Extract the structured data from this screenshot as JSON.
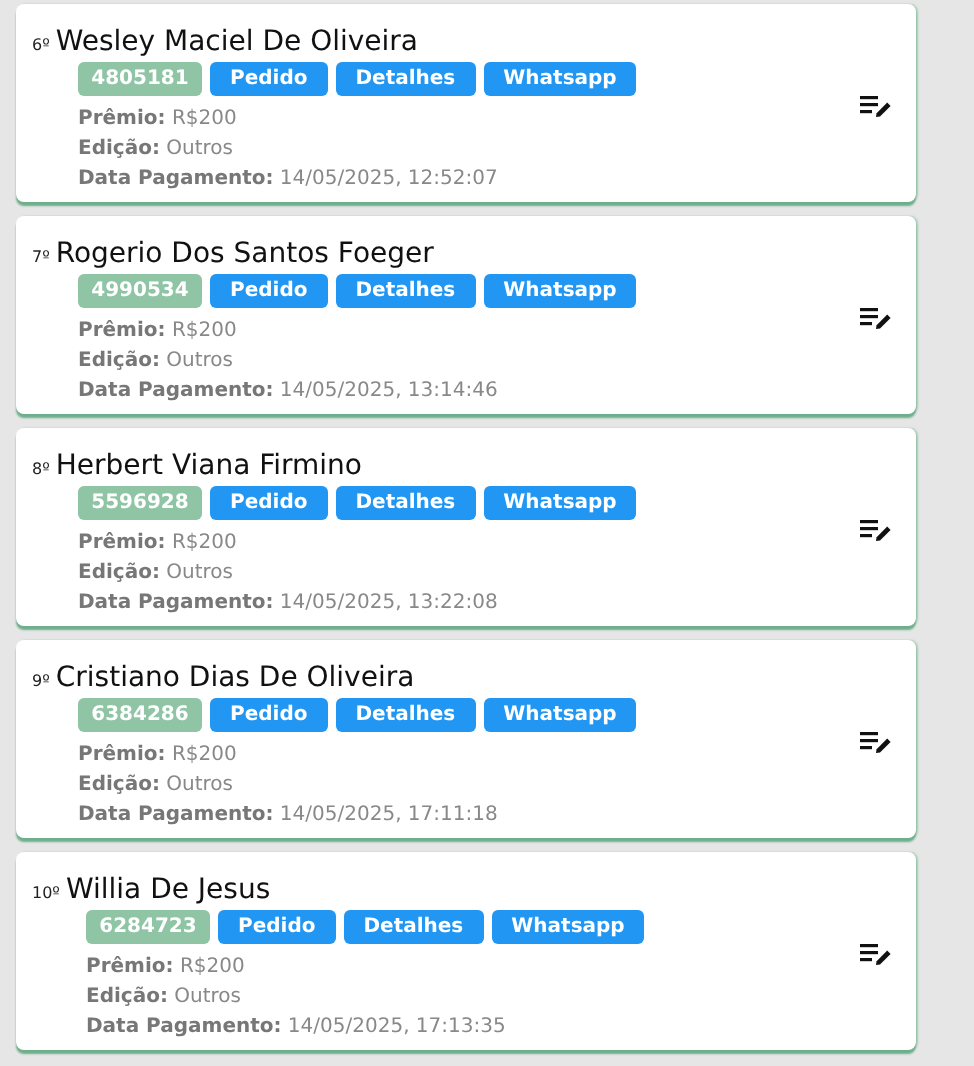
{
  "entries": [
    {
      "rank": "6º",
      "name": "Wesley Maciel De Oliveira",
      "code": "4805181",
      "buttons": [
        "Pedido",
        "Detalhes",
        "Whatsapp"
      ],
      "fields": [
        {
          "label": "Prêmio:",
          "value": "R$200"
        },
        {
          "label": "Edição:",
          "value": "Outros"
        },
        {
          "label": "Data Pagamento:",
          "value": "14/05/2025, 12:52:07"
        }
      ]
    },
    {
      "rank": "7º",
      "name": "Rogerio Dos Santos Foeger",
      "code": "4990534",
      "buttons": [
        "Pedido",
        "Detalhes",
        "Whatsapp"
      ],
      "fields": [
        {
          "label": "Prêmio:",
          "value": "R$200"
        },
        {
          "label": "Edição:",
          "value": "Outros"
        },
        {
          "label": "Data Pagamento:",
          "value": "14/05/2025, 13:14:46"
        }
      ]
    },
    {
      "rank": "8º",
      "name": "Herbert Viana Firmino",
      "code": "5596928",
      "buttons": [
        "Pedido",
        "Detalhes",
        "Whatsapp"
      ],
      "fields": [
        {
          "label": "Prêmio:",
          "value": "R$200"
        },
        {
          "label": "Edição:",
          "value": "Outros"
        },
        {
          "label": "Data Pagamento:",
          "value": "14/05/2025, 13:22:08"
        }
      ]
    },
    {
      "rank": "9º",
      "name": "Cristiano Dias De Oliveira",
      "code": "6384286",
      "buttons": [
        "Pedido",
        "Detalhes",
        "Whatsapp"
      ],
      "fields": [
        {
          "label": "Prêmio:",
          "value": "R$200"
        },
        {
          "label": "Edição:",
          "value": "Outros"
        },
        {
          "label": "Data Pagamento:",
          "value": "14/05/2025, 17:11:18"
        }
      ]
    },
    {
      "rank": "10º",
      "name": "Willia De Jesus",
      "code": "6284723",
      "buttons": [
        "Pedido",
        "Detalhes",
        "Whatsapp"
      ],
      "fields": [
        {
          "label": "Prêmio:",
          "value": "R$200"
        },
        {
          "label": "Edição:",
          "value": "Outros"
        },
        {
          "label": "Data Pagamento:",
          "value": "14/05/2025, 17:13:35"
        }
      ]
    }
  ]
}
